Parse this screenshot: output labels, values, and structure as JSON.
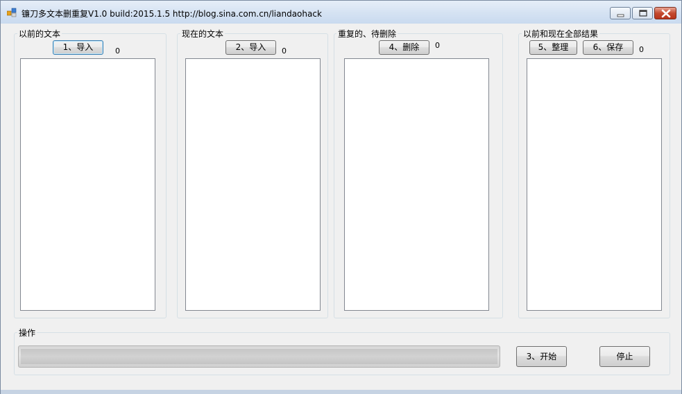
{
  "window": {
    "title": "镰刀多文本删重复V1.0  build:2015.1.5   http://blog.sina.com.cn/liandaohack"
  },
  "groups": {
    "previous": {
      "title": "以前的文本",
      "button": "1、导入",
      "count": "0"
    },
    "current": {
      "title": "现在的文本",
      "button": "2、导入",
      "count": "0"
    },
    "duplicates": {
      "title": "重复的、待删除",
      "button": "4、删除",
      "count": "0"
    },
    "result": {
      "title": "以前和现在全部结果",
      "button_organize": "5、整理",
      "button_save": "6、保存",
      "count": "0"
    }
  },
  "operation": {
    "title": "操作",
    "start_button": "3、开始",
    "stop_button": "停止",
    "progress": 0
  },
  "colors": {
    "progress_fill": "#3cb52a",
    "close_button": "#c44a2f"
  }
}
